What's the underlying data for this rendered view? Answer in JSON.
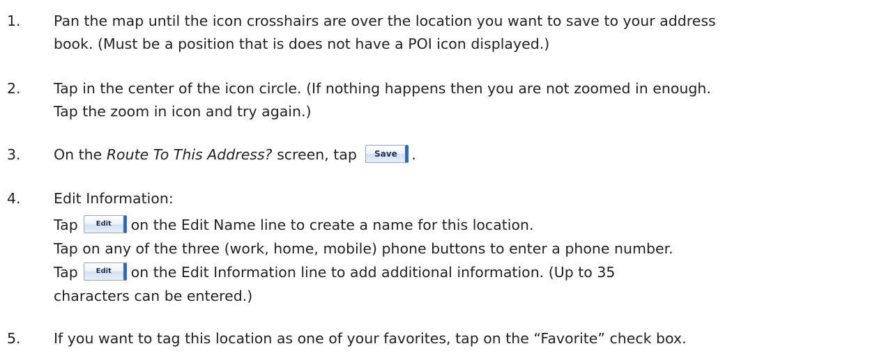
{
  "steps": [
    {
      "number": "1.",
      "line1": "Pan the map until the icon crosshairs are over the location you want to save to your address",
      "line2": "book.  (Must be a position that is does not have a POI icon displayed.)"
    },
    {
      "number": "2.",
      "line1": "Tap in the center of the icon circle. (If nothing happens then you are not zoomed in enough.",
      "line2": "Tap the zoom in icon and try again.)"
    },
    {
      "number": "3.",
      "prefix": "On the ",
      "screen_name": "Route To This Address?",
      "middle": " screen, tap ",
      "button_label": "Save",
      "suffix": "."
    },
    {
      "number": "4.",
      "heading": "Edit Information:",
      "sub1_prefix": "Tap",
      "sub1_button": "Edit",
      "sub1_suffix": "on the Edit Name line to create a name for this location.",
      "sub2": "Tap on any of the three (work, home, mobile) phone buttons to enter a phone number.",
      "sub3_prefix": "Tap",
      "sub3_button": "Edit",
      "sub3_suffix": "on the Edit Information line to add additional information.  (Up to 35",
      "sub3_line2": "characters can be entered.)"
    },
    {
      "number": "5.",
      "line1": "If you want to tag this location as one of your favorites, tap on the “Favorite” check box."
    }
  ]
}
